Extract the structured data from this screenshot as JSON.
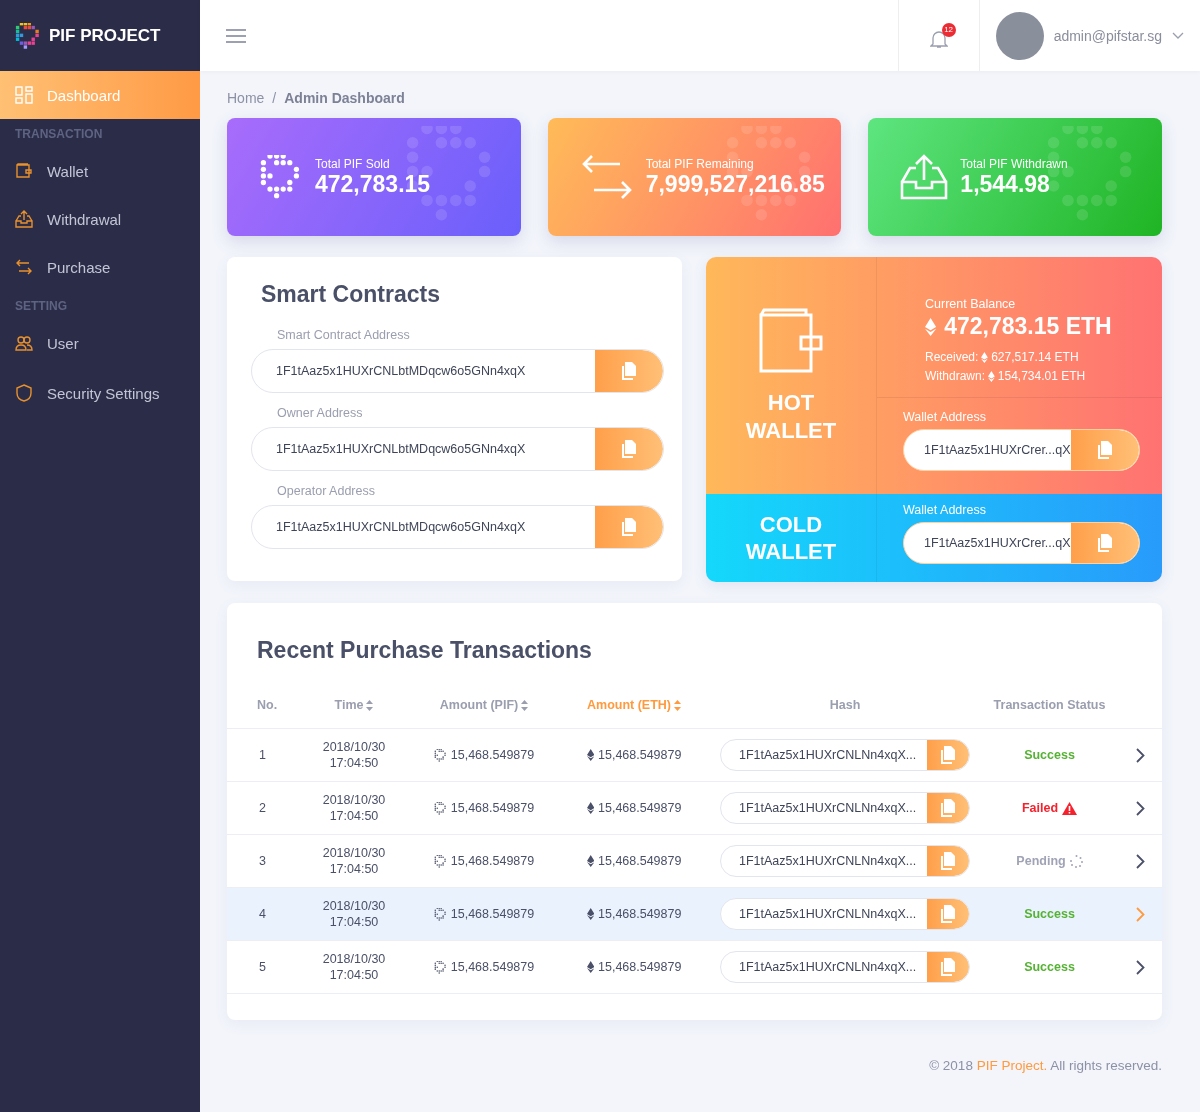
{
  "brand": {
    "name": "PIF PROJECT"
  },
  "sidebar": {
    "items": [
      {
        "kind": "item",
        "label": "Dashboard",
        "selected": true
      },
      {
        "kind": "section",
        "label": "TRANSACTION"
      },
      {
        "kind": "item",
        "label": "Wallet",
        "selected": false
      },
      {
        "kind": "item",
        "label": "Withdrawal",
        "selected": false
      },
      {
        "kind": "item",
        "label": "Purchase",
        "selected": false
      },
      {
        "kind": "section",
        "label": "SETTING"
      },
      {
        "kind": "item",
        "label": "User",
        "selected": false
      },
      {
        "kind": "item",
        "label": "Security Settings",
        "selected": false
      }
    ]
  },
  "header": {
    "notification_count": "12",
    "user": "admin@pifstar.sg"
  },
  "breadcrumb_separator": "/",
  "breadcrumb": [
    {
      "label": "Home",
      "selected": false
    },
    {
      "label": "Admin Dashboard",
      "selected": true
    }
  ],
  "stats": [
    {
      "kind": "sold",
      "label": "Total PIF Sold",
      "value": "472,783.15"
    },
    {
      "kind": "remaining",
      "label": "Total PIF Remaining",
      "value": "7,999,527,216.85"
    },
    {
      "kind": "withdrawn",
      "label": "Total PIF Withdrawn",
      "value": "1,544.98"
    }
  ],
  "smart_contracts": {
    "title": "Smart Contracts",
    "fields": [
      {
        "label": "Smart Contract Address",
        "value": "1F1tAaz5x1HUXrCNLbtMDqcw6o5GNn4xqX"
      },
      {
        "label": "Owner Address",
        "value": "1F1tAaz5x1HUXrCNLbtMDqcw6o5GNn4xqX"
      },
      {
        "label": "Operator Address",
        "value": "1F1tAaz5x1HUXrCNLbtMDqcw6o5GNn4xqX"
      }
    ]
  },
  "hot_wallet": {
    "title": "HOT WALLET",
    "balance_label": "Current Balance",
    "balance": "472,783.15 ETH",
    "received_label": "Received:",
    "received": "627,517.14 ETH",
    "withdrawn_label": "Withdrawn:",
    "withdrawn": "154,734.01 ETH",
    "address_label": "Wallet Address",
    "address": "1F1tAaz5x1HUXrCrer...qX"
  },
  "cold_wallet": {
    "title": "COLD WALLET",
    "address_label": "Wallet Address",
    "address": "1F1tAaz5x1HUXrCrer...qX"
  },
  "transactions": {
    "title": "Recent Purchase Transactions",
    "columns": [
      {
        "label": "No.",
        "sortable": false,
        "selected": false
      },
      {
        "label": "Time",
        "sortable": true,
        "selected": false
      },
      {
        "label": "Amount (PIF)",
        "sortable": true,
        "selected": false
      },
      {
        "label": "Amount (ETH)",
        "sortable": true,
        "selected": true
      },
      {
        "label": "Hash",
        "sortable": false,
        "selected": false
      },
      {
        "label": "Transaction Status",
        "sortable": false,
        "selected": false
      }
    ],
    "rows": [
      {
        "no": "1",
        "date": "2018/10/30",
        "time": "17:04:50",
        "pif": "15,468.549879",
        "eth": "15,468.549879",
        "hash": "1F1tAaz5x1HUXrCNLNn4xqX...",
        "status": "Success",
        "kind": "success",
        "selected": false
      },
      {
        "no": "2",
        "date": "2018/10/30",
        "time": "17:04:50",
        "pif": "15,468.549879",
        "eth": "15,468.549879",
        "hash": "1F1tAaz5x1HUXrCNLNn4xqX...",
        "status": "Failed",
        "kind": "failed",
        "selected": false
      },
      {
        "no": "3",
        "date": "2018/10/30",
        "time": "17:04:50",
        "pif": "15,468.549879",
        "eth": "15,468.549879",
        "hash": "1F1tAaz5x1HUXrCNLNn4xqX...",
        "status": "Pending",
        "kind": "pending",
        "selected": false
      },
      {
        "no": "4",
        "date": "2018/10/30",
        "time": "17:04:50",
        "pif": "15,468.549879",
        "eth": "15,468.549879",
        "hash": "1F1tAaz5x1HUXrCNLNn4xqX...",
        "status": "Success",
        "kind": "success",
        "selected": true
      },
      {
        "no": "5",
        "date": "2018/10/30",
        "time": "17:04:50",
        "pif": "15,468.549879",
        "eth": "15,468.549879",
        "hash": "1F1tAaz5x1HUXrCNLNn4xqX...",
        "status": "Success",
        "kind": "success",
        "selected": false
      }
    ]
  },
  "footer": {
    "prefix": "© 2018",
    "link": "PIF Project.",
    "suffix": "All rights reserved."
  }
}
